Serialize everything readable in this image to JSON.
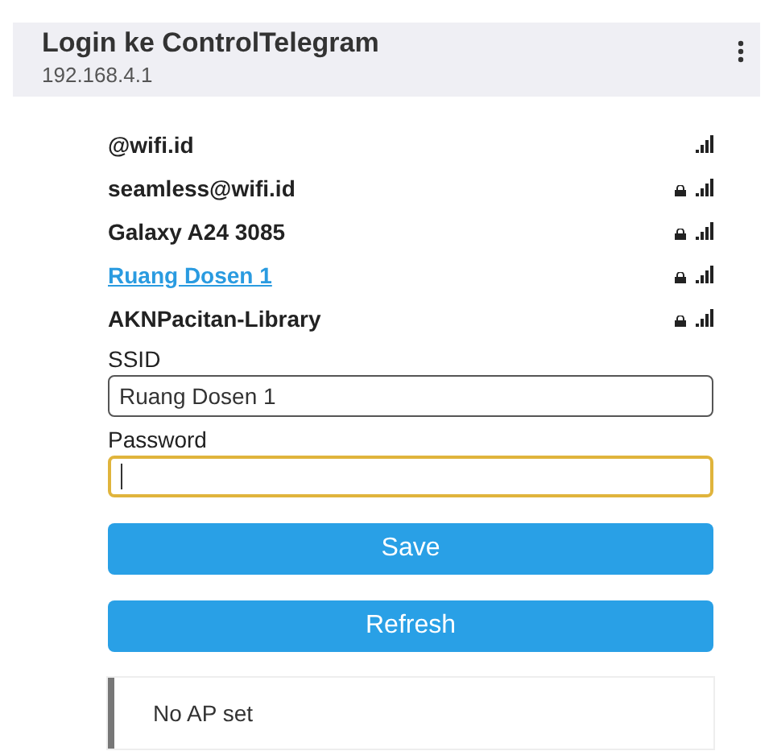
{
  "header": {
    "title": "Login ke ControlTelegram",
    "subtitle": "192.168.4.1"
  },
  "networks": [
    {
      "name": "@wifi.id",
      "locked": false,
      "selected": false
    },
    {
      "name": "seamless@wifi.id",
      "locked": true,
      "selected": false
    },
    {
      "name": "Galaxy A24 3085",
      "locked": true,
      "selected": false
    },
    {
      "name": "Ruang Dosen 1",
      "locked": true,
      "selected": true
    },
    {
      "name": "AKNPacitan-Library",
      "locked": true,
      "selected": false
    }
  ],
  "fields": [
    {
      "label": "SSID",
      "value": "Ruang Dosen 1",
      "focused": false
    },
    {
      "label": "Password",
      "focused": true
    }
  ],
  "buttons": [
    "Save",
    "Refresh"
  ],
  "message": "No AP set"
}
